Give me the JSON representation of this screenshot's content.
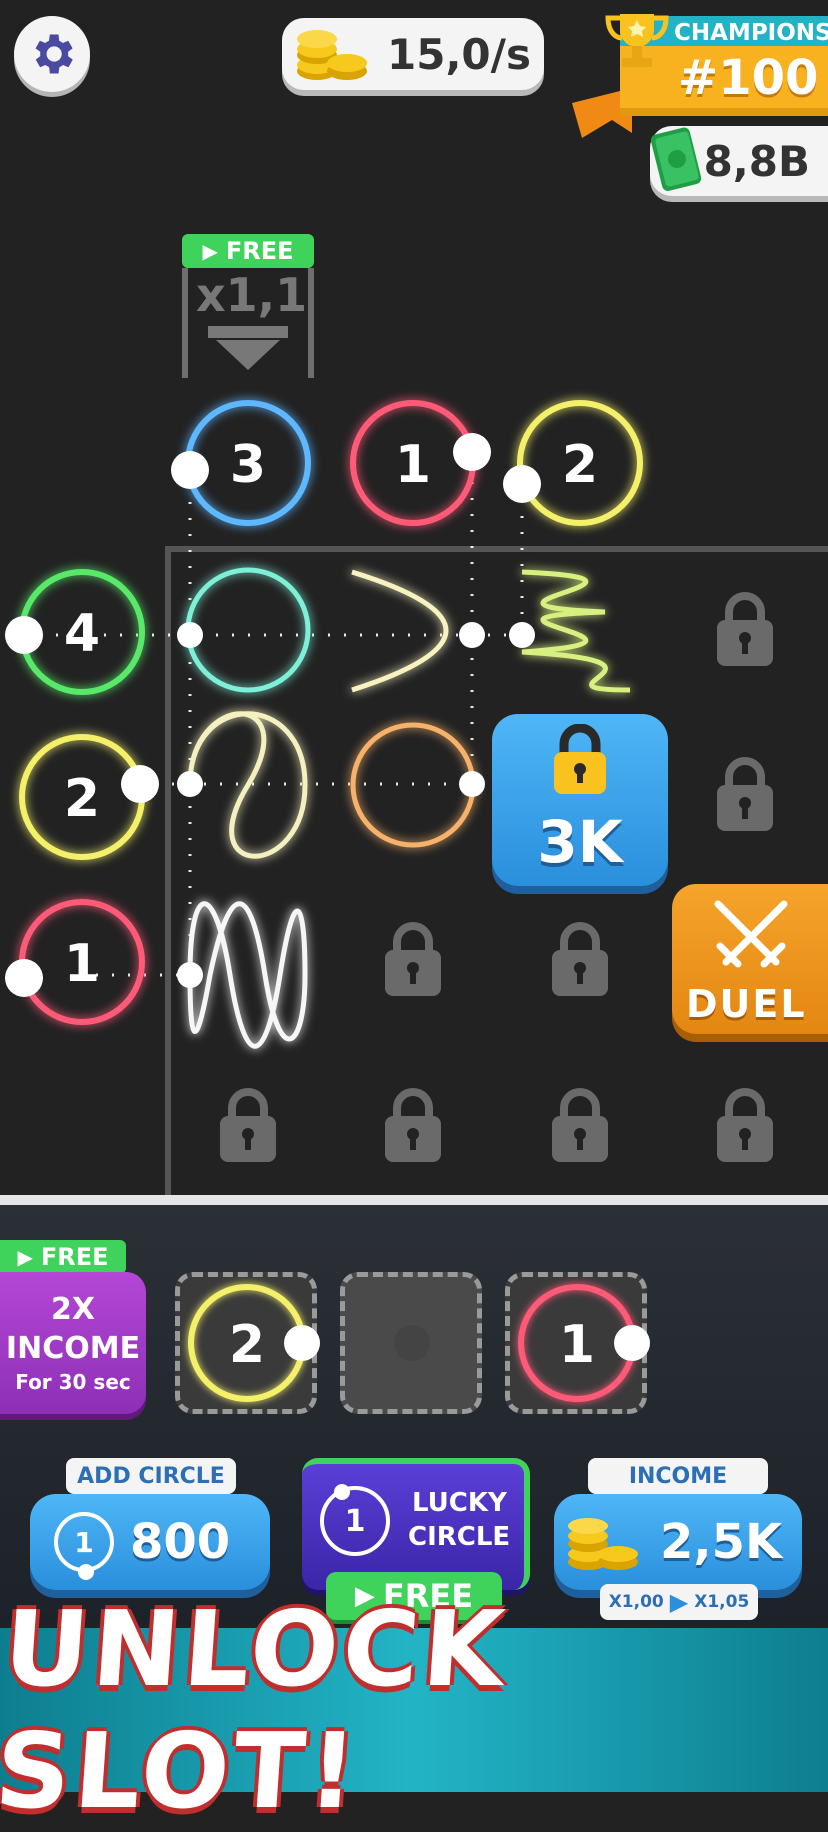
{
  "hud": {
    "rate": "15,0/s",
    "champions_label": "CHAMPIONS",
    "champions_rank": "#100",
    "cash": "8,8B"
  },
  "boost_gate": {
    "free_label": "FREE",
    "multiplier": "x1,1"
  },
  "top_emitters": [
    {
      "value": "3",
      "color": "#5fb7ff"
    },
    {
      "value": "1",
      "color": "#ff5a78"
    },
    {
      "value": "2",
      "color": "#f4f06a"
    }
  ],
  "left_emitters": [
    {
      "value": "4",
      "color": "#58e86a"
    },
    {
      "value": "2",
      "color": "#f4f06a"
    },
    {
      "value": "1",
      "color": "#ff5a78"
    }
  ],
  "unlock_tile": {
    "price": "3K"
  },
  "duel_button": {
    "label": "DUEL"
  },
  "income_boost": {
    "free_label": "FREE",
    "line1": "2X",
    "line2": "INCOME",
    "line3": "For 30 sec"
  },
  "tray_slots": [
    {
      "value": "2",
      "color": "#f4f06a"
    },
    {
      "value": ""
    },
    {
      "value": "1",
      "color": "#ff5a78"
    }
  ],
  "add_circle": {
    "label": "ADD CIRCLE",
    "circle_value": "1",
    "price": "800"
  },
  "lucky_circle": {
    "circle_value": "1",
    "line1": "LUCKY",
    "line2": "CIRCLE",
    "free_label": "FREE"
  },
  "income": {
    "label": "INCOME",
    "value": "2,5K",
    "from": "X1,00",
    "to": "X1,05"
  },
  "banner": {
    "text": "UNLOCK SLOT!"
  },
  "colors": {
    "blue": "#5fb7ff",
    "red": "#ff5a78",
    "yellow": "#f4f06a",
    "green": "#58e86a",
    "orange": "#f6b26b",
    "white": "#ffffff"
  }
}
